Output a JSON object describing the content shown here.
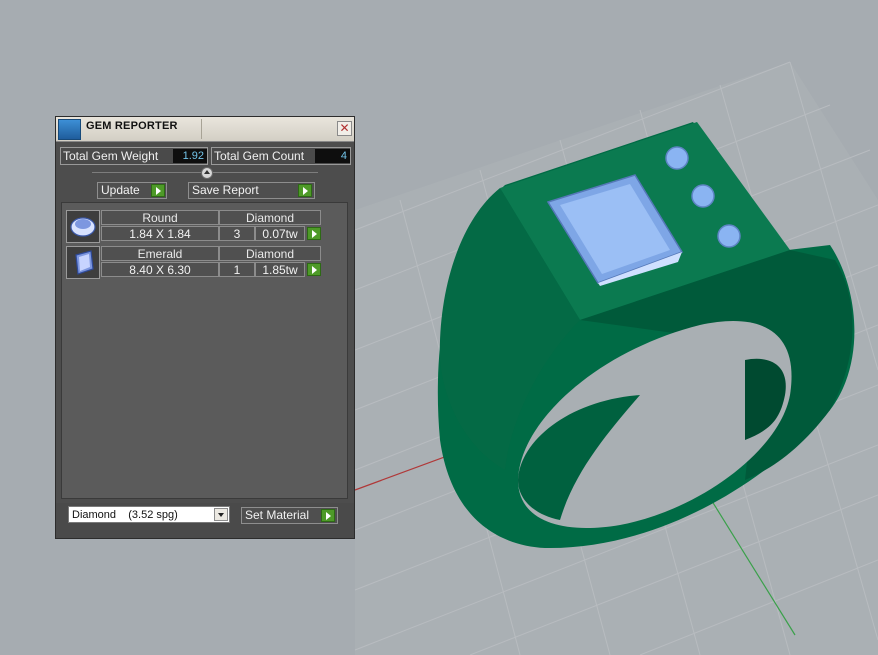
{
  "panel": {
    "title": "GEM REPORTER",
    "close_label": "✕",
    "total_weight_label": "Total Gem Weight",
    "total_weight_value": "1.92",
    "total_count_label": "Total Gem Count",
    "total_count_value": "4",
    "update_label": "Update",
    "save_report_label": "Save Report",
    "gems": [
      {
        "cut": "Round",
        "material": "Diamond",
        "size": "1.84 X 1.84",
        "count": "3",
        "weight": "0.07tw",
        "icon": "round-gem-icon"
      },
      {
        "cut": "Emerald",
        "material": "Diamond",
        "size": "8.40 X 6.30",
        "count": "1",
        "weight": "1.85tw",
        "icon": "emerald-gem-icon"
      }
    ],
    "material_select_value": "Diamond    (3.52 spg)",
    "set_material_label": "Set Material"
  },
  "viewport": {
    "background": "#a6acb1",
    "ring_color": "#006b45",
    "gem_color": "#8ab4f2"
  }
}
